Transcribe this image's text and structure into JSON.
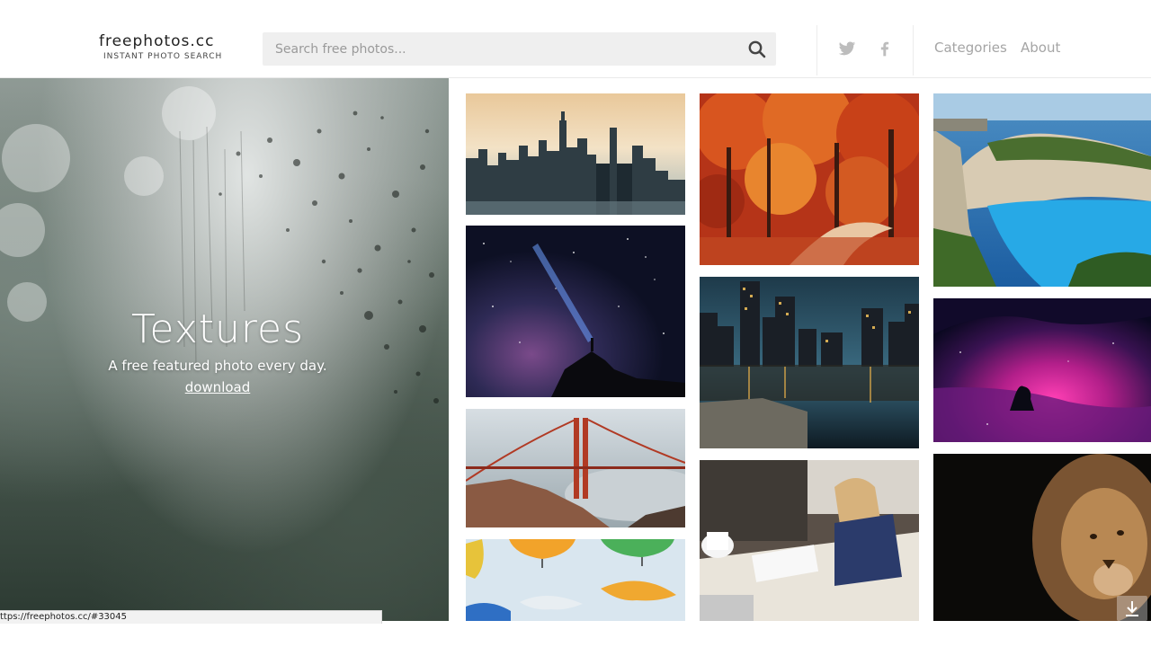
{
  "header": {
    "logo_name": "freephotos.cc",
    "logo_tagline": "INSTANT PHOTO SEARCH",
    "search_placeholder": "Search free photos...",
    "nav": {
      "categories": "Categories",
      "about": "About"
    }
  },
  "hero": {
    "title": "Textures",
    "subtitle": "A free featured photo every day.",
    "download_link": "download"
  },
  "status_url": "ttps://freephotos.cc/#33045",
  "icons": {
    "search": "search-icon",
    "twitter": "twitter-icon",
    "facebook": "facebook-icon",
    "download": "download-icon"
  },
  "colors": {
    "nav_text": "#a5a5a5",
    "search_bg": "#efefef"
  }
}
